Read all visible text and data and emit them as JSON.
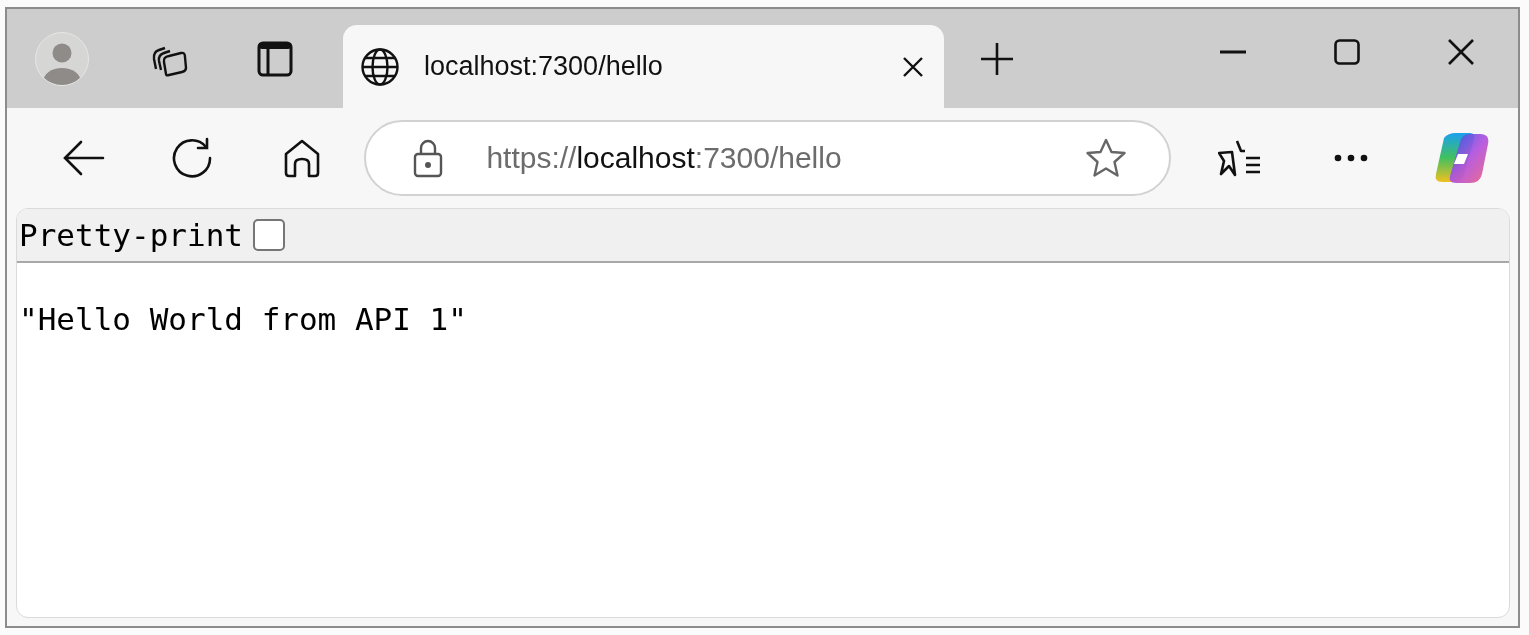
{
  "tab": {
    "title": "localhost:7300/hello",
    "selected": true
  },
  "address_bar": {
    "scheme": "https://",
    "host": "localhost",
    "path": ":7300/hello"
  },
  "toolbar": {
    "label": "Pretty-print",
    "checked": false
  },
  "body": {
    "text": "\"Hello World from API 1\""
  }
}
